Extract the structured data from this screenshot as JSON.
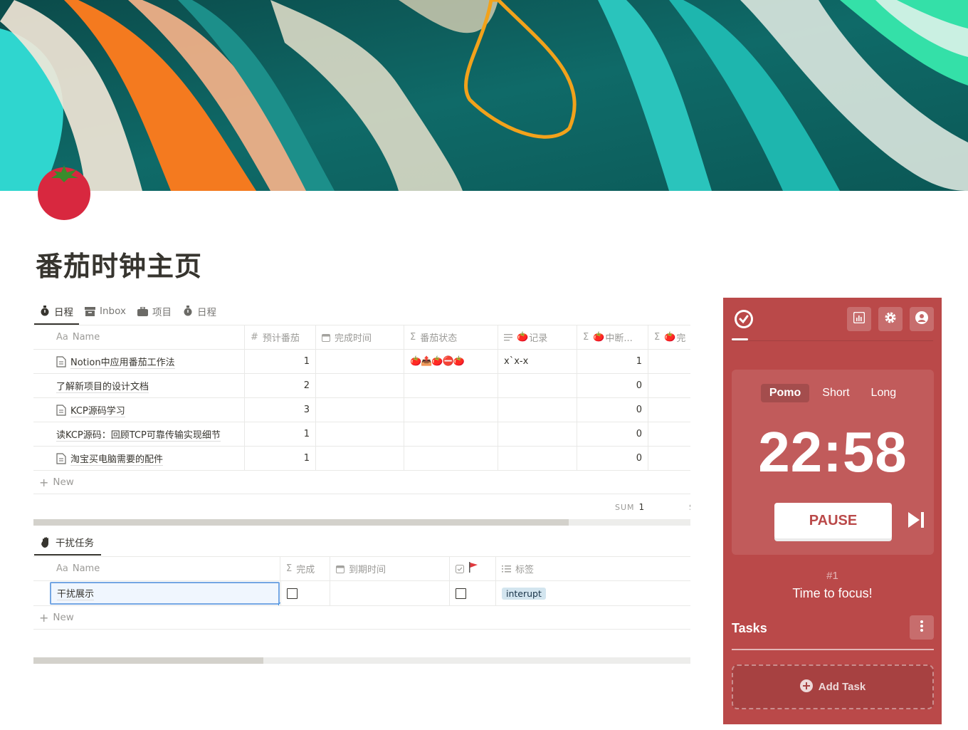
{
  "page": {
    "title": "番茄时钟主页"
  },
  "colors": {
    "widget_bg": "#ba4949",
    "tag_bg": "#d3e5ef",
    "text": "#37352f",
    "muted": "#9b9a97"
  },
  "tabs": [
    {
      "label": "日程",
      "icon": "stopwatch-icon",
      "active": true
    },
    {
      "label": "Inbox",
      "icon": "archive-box-icon",
      "active": false
    },
    {
      "label": "项目",
      "icon": "briefcase-icon",
      "active": false
    },
    {
      "label": "日程",
      "icon": "stopwatch-icon",
      "active": false
    }
  ],
  "main_table": {
    "columns": [
      "Name",
      "预计番茄",
      "完成时间",
      "番茄状态",
      "记录",
      "中断...",
      "完"
    ],
    "column_icons": [
      "Aa",
      "#",
      "calendar-icon",
      "Σ",
      "text-lines-icon",
      "Σ",
      "Σ"
    ],
    "rows": [
      {
        "name": "Notion中应用番茄工作法",
        "has_doc_icon": true,
        "estimate": "1",
        "done": "",
        "status": "🍅📤🍅⛔🍅",
        "record": "x`x-x",
        "interrupt": "1"
      },
      {
        "name": "了解新项目的设计文档",
        "has_doc_icon": false,
        "estimate": "2",
        "done": "",
        "status": "",
        "record": "",
        "interrupt": "0"
      },
      {
        "name": "KCP源码学习",
        "has_doc_icon": true,
        "estimate": "3",
        "done": "",
        "status": "",
        "record": "",
        "interrupt": "0"
      },
      {
        "name": "读KCP源码：回顾TCP可靠传输实现细节",
        "has_doc_icon": false,
        "estimate": "1",
        "done": "",
        "status": "",
        "record": "",
        "interrupt": "0"
      },
      {
        "name": "淘宝买电脑需要的配件",
        "has_doc_icon": true,
        "estimate": "1",
        "done": "",
        "status": "",
        "record": "",
        "interrupt": "0"
      }
    ],
    "new_label": "New",
    "sum_label": "SUM",
    "sum_value": "1",
    "sum_cut": "S",
    "scroll_fraction": 0.815
  },
  "interrupt_tab": {
    "label": "干扰任务",
    "icon": "hand-icon"
  },
  "interrupt_table": {
    "columns": [
      "Name",
      "完成",
      "到期时间",
      "",
      "标签"
    ],
    "column_icons": [
      "Aa",
      "Σ",
      "calendar-icon",
      "checkbox-icon",
      "list-icon"
    ],
    "rows": [
      {
        "name": "干扰展示",
        "done": false,
        "flag": false,
        "tag": "interupt"
      }
    ],
    "new_label": "New",
    "scroll_fraction": 0.35
  },
  "pomo": {
    "modes": [
      "Pomo",
      "Short",
      "Long"
    ],
    "active_mode": "Pomo",
    "time": "22:58",
    "pause_label": "PAUSE",
    "cycle": "#1",
    "message": "Time to focus!",
    "tasks_label": "Tasks",
    "add_task_label": "Add Task"
  }
}
